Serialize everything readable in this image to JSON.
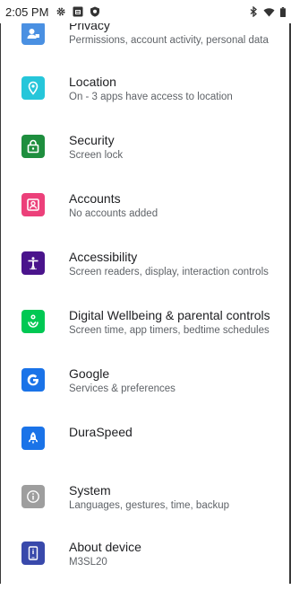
{
  "status_bar": {
    "time": "2:05 PM",
    "left_icons": [
      "gear-icon",
      "image-notification-icon",
      "shield-icon"
    ],
    "right_icons": [
      "bluetooth-icon",
      "wifi-icon",
      "battery-icon"
    ]
  },
  "settings": {
    "items": [
      {
        "key": "privacy",
        "title": "Privacy",
        "subtitle": "Permissions, account activity, personal data",
        "icon": "privacy-icon",
        "color": "#4a90e2"
      },
      {
        "key": "location",
        "title": "Location",
        "subtitle": "On - 3 apps have access to location",
        "icon": "location-icon",
        "color": "#26c6da"
      },
      {
        "key": "security",
        "title": "Security",
        "subtitle": "Screen lock",
        "icon": "lock-icon",
        "color": "#1e8e3e"
      },
      {
        "key": "accounts",
        "title": "Accounts",
        "subtitle": "No accounts added",
        "icon": "account-icon",
        "color": "#ec407a"
      },
      {
        "key": "accessibility",
        "title": "Accessibility",
        "subtitle": "Screen readers, display, interaction controls",
        "icon": "accessibility-icon",
        "color": "#4a148c"
      },
      {
        "key": "wellbeing",
        "title": "Digital Wellbeing & parental controls",
        "subtitle": "Screen time, app timers, bedtime schedules",
        "icon": "wellbeing-icon",
        "color": "#00c853"
      },
      {
        "key": "google",
        "title": "Google",
        "subtitle": "Services & preferences",
        "icon": "google-icon",
        "color": "#1a73e8"
      },
      {
        "key": "duraspeed",
        "title": "DuraSpeed",
        "subtitle": "",
        "icon": "rocket-icon",
        "color": "#1a73e8"
      },
      {
        "key": "system",
        "title": "System",
        "subtitle": "Languages, gestures, time, backup",
        "icon": "info-icon",
        "color": "#9e9e9e"
      },
      {
        "key": "about",
        "title": "About device",
        "subtitle": "M3SL20",
        "icon": "phone-icon",
        "color": "#3949ab"
      }
    ]
  }
}
